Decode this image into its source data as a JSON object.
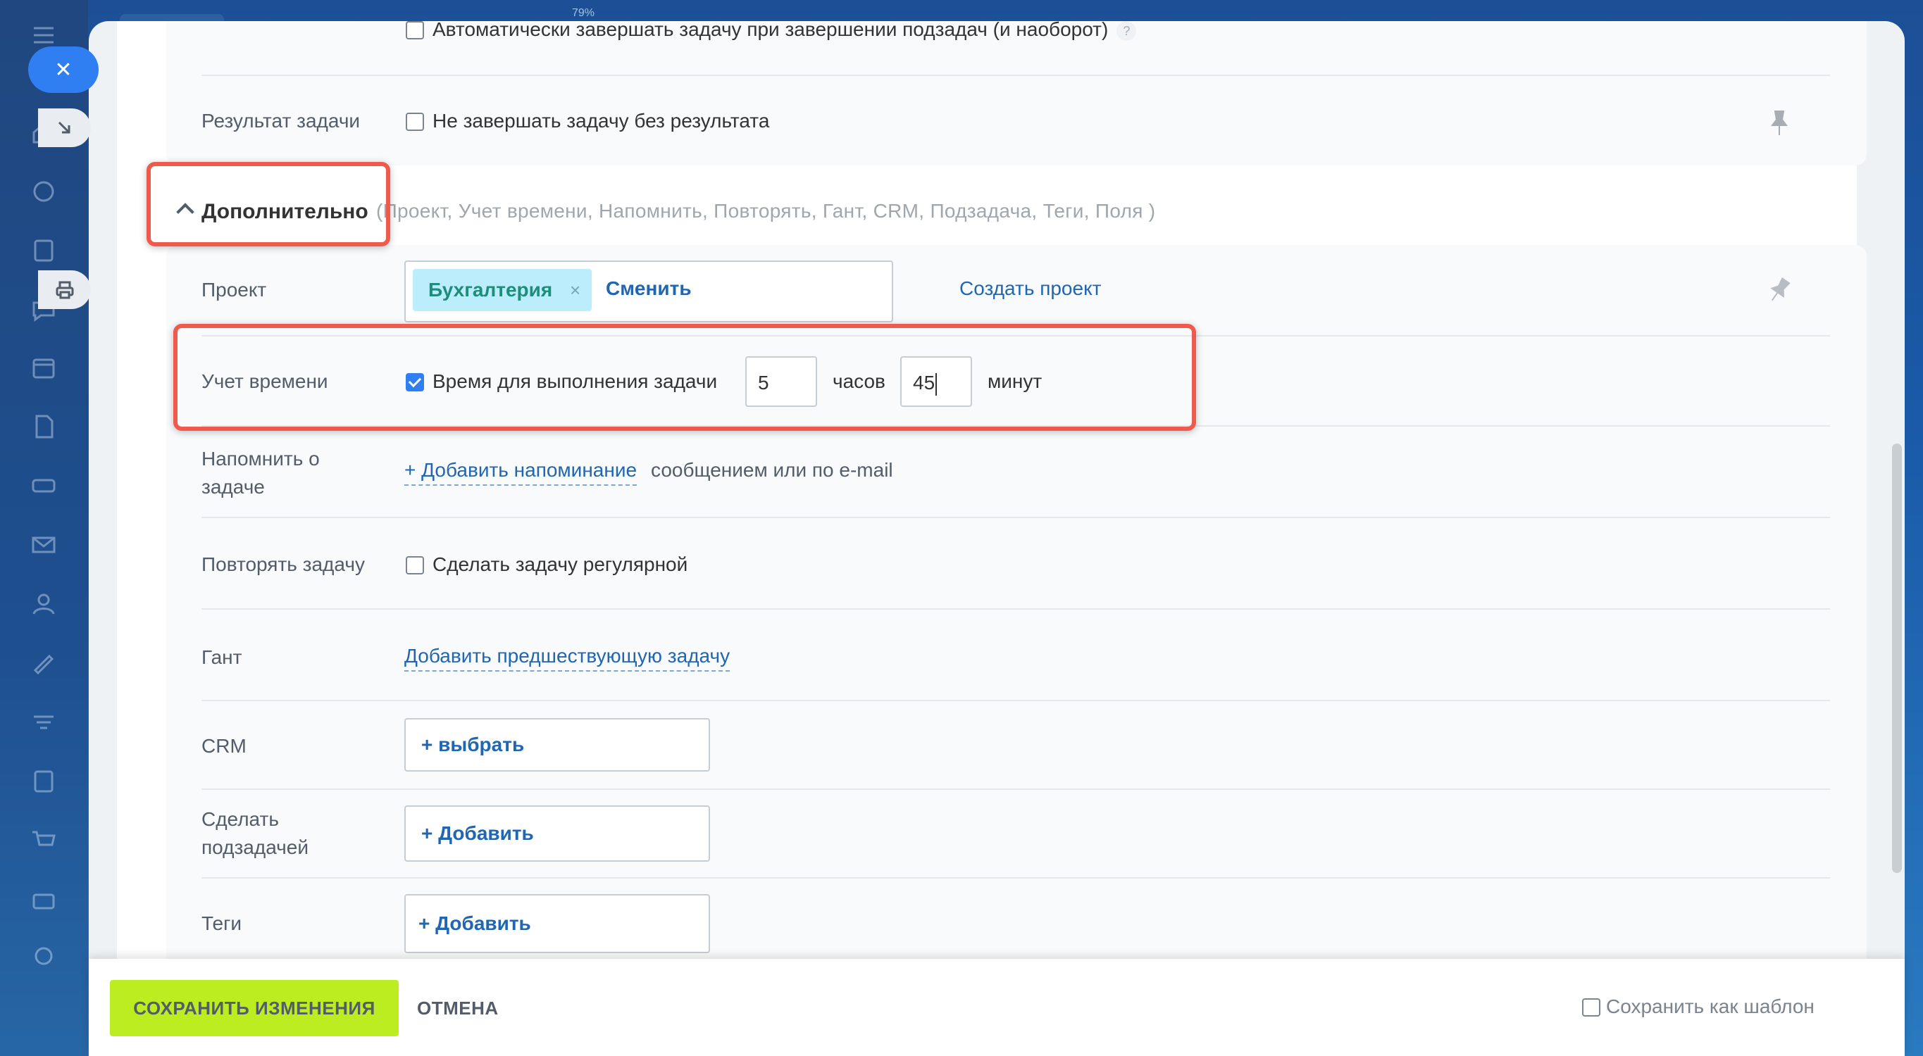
{
  "window": {
    "zoom_label": "79%"
  },
  "sidebar": {
    "icons": [
      "menu-icon",
      "home-icon",
      "palette-icon",
      "news-icon",
      "chat-icon",
      "calendar-icon",
      "document-icon",
      "drive-icon",
      "mail-icon",
      "contacts-icon",
      "sign-icon",
      "filter-icon",
      "checklist-icon",
      "cart-icon",
      "briefcase-icon",
      "settings-icon"
    ]
  },
  "form": {
    "auto_complete_label": "Автоматически завершать задачу при завершении подзадач (и наоборот)",
    "help_glyph": "?",
    "result": {
      "label": "Результат задачи",
      "checkbox_label": "Не завершать задачу без результата"
    },
    "extra": {
      "title": "Дополнительно",
      "summary": "(Проект,  Учет времени,  Напомнить,  Повторять,  Гант,  CRM,  Подзадача,  Теги,  Поля )"
    },
    "project": {
      "label": "Проект",
      "tag": "Бухгалтерия",
      "tag_remove": "×",
      "change": "Сменить",
      "create_link": "Создать проект"
    },
    "time": {
      "label": "Учет времени",
      "checkbox_label": "Время для выполнения задачи",
      "checked": true,
      "hours_value": "5",
      "hours_unit": "часов",
      "minutes_value": "45",
      "minutes_unit": "минут"
    },
    "remind": {
      "label_line1": "Напомнить о",
      "label_line2": "задаче",
      "link": "+ Добавить напоминание",
      "suffix": "сообщением или по e-mail"
    },
    "repeat": {
      "label": "Повторять задачу",
      "checkbox_label": "Сделать задачу регулярной"
    },
    "gantt": {
      "label": "Гант",
      "link": "Добавить предшествующую задачу"
    },
    "crm": {
      "label": "CRM",
      "button": "+  выбрать"
    },
    "subtask": {
      "label_line1": "Сделать",
      "label_line2": "подзадачей",
      "button": "+ Добавить"
    },
    "tags": {
      "label": "Теги",
      "button": "+ Добавить"
    }
  },
  "footer": {
    "save": "СОХРАНИТЬ ИЗМЕНЕНИЯ",
    "cancel": "ОТМЕНА",
    "template_label": "Сохранить как шаблон"
  },
  "colors": {
    "accent_blue": "#2f7ff2",
    "link_blue": "#2066b0",
    "save_green": "#bbed21",
    "highlight_red": "#f05a4d",
    "tag_bg": "#bcedfc"
  }
}
